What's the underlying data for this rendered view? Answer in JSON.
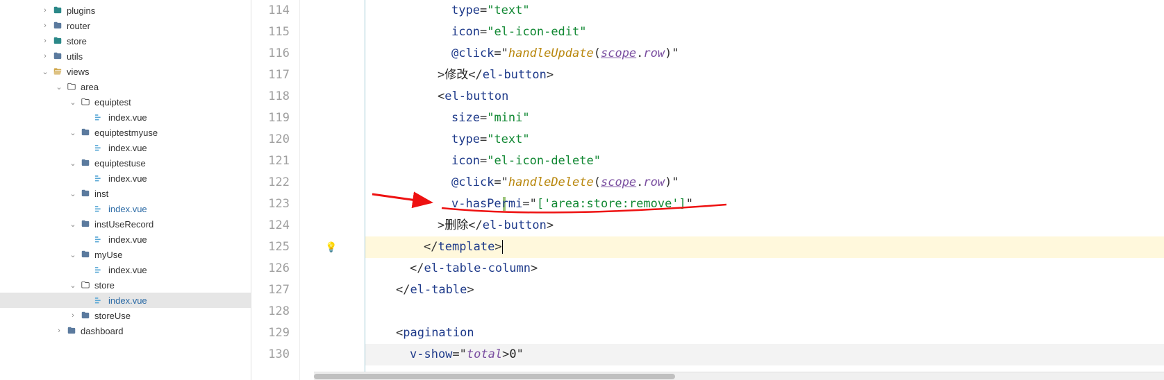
{
  "sidebar": {
    "items": [
      {
        "indent": 56,
        "chev": "›",
        "icon": "folder-closed",
        "iconClass": "folder-teal",
        "label": "plugins"
      },
      {
        "indent": 56,
        "chev": "›",
        "icon": "folder-closed",
        "iconClass": "folder-closed",
        "label": "router"
      },
      {
        "indent": 56,
        "chev": "›",
        "icon": "folder-closed",
        "iconClass": "folder-teal",
        "label": "store"
      },
      {
        "indent": 56,
        "chev": "›",
        "icon": "folder-closed",
        "iconClass": "folder-closed",
        "label": "utils"
      },
      {
        "indent": 56,
        "chev": "⌄",
        "icon": "folder-open",
        "iconClass": "folder-open",
        "label": "views"
      },
      {
        "indent": 76,
        "chev": "⌄",
        "icon": "folder-outline",
        "iconClass": "folder-dark",
        "label": "area"
      },
      {
        "indent": 96,
        "chev": "⌄",
        "icon": "folder-outline",
        "iconClass": "folder-dark",
        "label": "equiptest"
      },
      {
        "indent": 116,
        "chev": "",
        "icon": "file-vue",
        "iconClass": "file-vue",
        "label": "index.vue"
      },
      {
        "indent": 96,
        "chev": "⌄",
        "icon": "folder-closed",
        "iconClass": "folder-closed",
        "label": "equiptestmyuse"
      },
      {
        "indent": 116,
        "chev": "",
        "icon": "file-vue",
        "iconClass": "file-vue",
        "label": "index.vue"
      },
      {
        "indent": 96,
        "chev": "⌄",
        "icon": "folder-closed",
        "iconClass": "folder-closed",
        "label": "equiptestuse"
      },
      {
        "indent": 116,
        "chev": "",
        "icon": "file-vue",
        "iconClass": "file-vue",
        "label": "index.vue"
      },
      {
        "indent": 96,
        "chev": "⌄",
        "icon": "folder-closed",
        "iconClass": "folder-closed",
        "label": "inst"
      },
      {
        "indent": 116,
        "chev": "",
        "icon": "file-vue",
        "iconClass": "file-vue active",
        "label": "index.vue",
        "active": true
      },
      {
        "indent": 96,
        "chev": "⌄",
        "icon": "folder-closed",
        "iconClass": "folder-closed",
        "label": "instUseRecord"
      },
      {
        "indent": 116,
        "chev": "",
        "icon": "file-vue",
        "iconClass": "file-vue",
        "label": "index.vue"
      },
      {
        "indent": 96,
        "chev": "⌄",
        "icon": "folder-closed",
        "iconClass": "folder-closed",
        "label": "myUse"
      },
      {
        "indent": 116,
        "chev": "",
        "icon": "file-vue",
        "iconClass": "file-vue",
        "label": "index.vue"
      },
      {
        "indent": 96,
        "chev": "⌄",
        "icon": "folder-outline",
        "iconClass": "folder-dark",
        "label": "store"
      },
      {
        "indent": 116,
        "chev": "",
        "icon": "file-vue",
        "iconClass": "file-vue active",
        "label": "index.vue",
        "active": true,
        "selected": true
      },
      {
        "indent": 96,
        "chev": "›",
        "icon": "folder-closed",
        "iconClass": "folder-closed",
        "label": "storeUse"
      },
      {
        "indent": 76,
        "chev": "›",
        "icon": "folder-closed",
        "iconClass": "folder-closed",
        "label": "dashboard"
      }
    ]
  },
  "editor": {
    "line_numbers": [
      "114",
      "115",
      "116",
      "117",
      "118",
      "119",
      "120",
      "121",
      "122",
      "123",
      "124",
      "125",
      "126",
      "127",
      "128",
      "129",
      "130"
    ],
    "modified_lines": [
      123
    ],
    "highlighted_line": 125,
    "cursor_line": 125,
    "arrow_annotation_line": 123,
    "lines": [
      {
        "n": 114,
        "indent": 12,
        "segs": [
          {
            "cls": "t-attr",
            "t": "type"
          },
          {
            "cls": "t-punc",
            "t": "="
          },
          {
            "cls": "t-str",
            "t": "\"text\""
          }
        ]
      },
      {
        "n": 115,
        "indent": 12,
        "segs": [
          {
            "cls": "t-attr",
            "t": "icon"
          },
          {
            "cls": "t-punc",
            "t": "="
          },
          {
            "cls": "t-str",
            "t": "\"el-icon-edit\""
          }
        ]
      },
      {
        "n": 116,
        "indent": 12,
        "segs": [
          {
            "cls": "t-attr",
            "t": "@click"
          },
          {
            "cls": "t-punc",
            "t": "=\""
          },
          {
            "cls": "t-func",
            "t": "handleUpdate"
          },
          {
            "cls": "t-punc",
            "t": "("
          },
          {
            "cls": "t-ident underline",
            "t": "scope"
          },
          {
            "cls": "t-punc",
            "t": "."
          },
          {
            "cls": "t-ident",
            "t": "row"
          },
          {
            "cls": "t-punc",
            "t": ")\""
          }
        ]
      },
      {
        "n": 117,
        "indent": 10,
        "segs": [
          {
            "cls": "t-punc",
            "t": ">"
          },
          {
            "cls": "t-text",
            "t": "修改"
          },
          {
            "cls": "t-punc",
            "t": "</"
          },
          {
            "cls": "t-tag",
            "t": "el-button"
          },
          {
            "cls": "t-punc",
            "t": ">"
          }
        ]
      },
      {
        "n": 118,
        "indent": 10,
        "segs": [
          {
            "cls": "t-punc",
            "t": "<"
          },
          {
            "cls": "t-tag",
            "t": "el-button"
          }
        ]
      },
      {
        "n": 119,
        "indent": 12,
        "segs": [
          {
            "cls": "t-attr",
            "t": "size"
          },
          {
            "cls": "t-punc",
            "t": "="
          },
          {
            "cls": "t-str",
            "t": "\"mini\""
          }
        ]
      },
      {
        "n": 120,
        "indent": 12,
        "segs": [
          {
            "cls": "t-attr",
            "t": "type"
          },
          {
            "cls": "t-punc",
            "t": "="
          },
          {
            "cls": "t-str",
            "t": "\"text\""
          }
        ]
      },
      {
        "n": 121,
        "indent": 12,
        "segs": [
          {
            "cls": "t-attr",
            "t": "icon"
          },
          {
            "cls": "t-punc",
            "t": "="
          },
          {
            "cls": "t-str",
            "t": "\"el-icon-delete\""
          }
        ]
      },
      {
        "n": 122,
        "indent": 12,
        "segs": [
          {
            "cls": "t-attr",
            "t": "@click"
          },
          {
            "cls": "t-punc",
            "t": "=\""
          },
          {
            "cls": "t-func",
            "t": "handleDelete"
          },
          {
            "cls": "t-punc",
            "t": "("
          },
          {
            "cls": "t-ident underline",
            "t": "scope"
          },
          {
            "cls": "t-punc",
            "t": "."
          },
          {
            "cls": "t-ident",
            "t": "row"
          },
          {
            "cls": "t-punc",
            "t": ")\""
          }
        ]
      },
      {
        "n": 123,
        "indent": 12,
        "segs": [
          {
            "cls": "t-attr",
            "t": "v-hasPermi"
          },
          {
            "cls": "t-punc",
            "t": "=\""
          },
          {
            "cls": "t-str",
            "t": "['area:store:remove']"
          },
          {
            "cls": "t-punc",
            "t": "\""
          }
        ]
      },
      {
        "n": 124,
        "indent": 10,
        "segs": [
          {
            "cls": "t-punc",
            "t": ">"
          },
          {
            "cls": "t-text",
            "t": "删除"
          },
          {
            "cls": "t-punc",
            "t": "</"
          },
          {
            "cls": "t-tag",
            "t": "el-button"
          },
          {
            "cls": "t-punc",
            "t": ">"
          }
        ]
      },
      {
        "n": 125,
        "indent": 8,
        "hl": true,
        "segs": [
          {
            "cls": "t-punc",
            "t": "</"
          },
          {
            "cls": "t-tag",
            "t": "template"
          },
          {
            "cls": "t-punc",
            "t": ">"
          },
          {
            "cls": "t-caret",
            "t": ""
          }
        ]
      },
      {
        "n": 126,
        "indent": 6,
        "segs": [
          {
            "cls": "t-punc",
            "t": "</"
          },
          {
            "cls": "t-tag",
            "t": "el-table-column"
          },
          {
            "cls": "t-punc",
            "t": ">"
          }
        ]
      },
      {
        "n": 127,
        "indent": 4,
        "segs": [
          {
            "cls": "t-punc",
            "t": "</"
          },
          {
            "cls": "t-tag",
            "t": "el-table"
          },
          {
            "cls": "t-punc",
            "t": ">"
          }
        ]
      },
      {
        "n": 128,
        "indent": 0,
        "segs": []
      },
      {
        "n": 129,
        "indent": 4,
        "segs": [
          {
            "cls": "t-punc",
            "t": "<"
          },
          {
            "cls": "t-tag",
            "t": "pagination"
          }
        ]
      },
      {
        "n": 130,
        "indent": 6,
        "dim": true,
        "segs": [
          {
            "cls": "t-attr",
            "t": "v-show"
          },
          {
            "cls": "t-punc",
            "t": "=\""
          },
          {
            "cls": "t-ident",
            "t": "total"
          },
          {
            "cls": "t-punc",
            "t": ">"
          },
          {
            "cls": "t-text",
            "t": "0"
          },
          {
            "cls": "t-punc",
            "t": "\""
          }
        ]
      }
    ]
  }
}
